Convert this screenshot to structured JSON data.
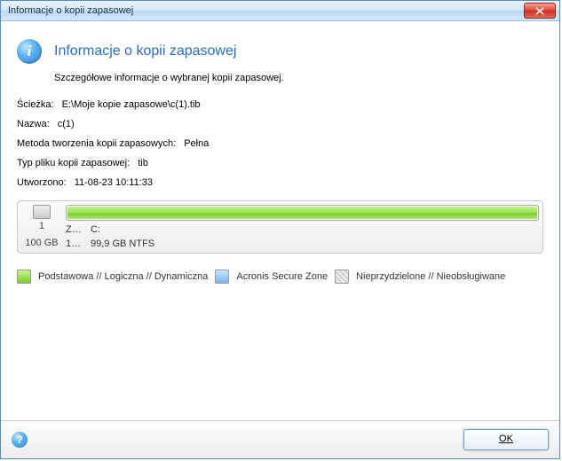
{
  "window": {
    "title": "Informacje o kopii zapasowej"
  },
  "header": {
    "title": "Informacje o kopii zapasowej",
    "subtitle": "Szczegółowe informacje o wybranej kopii zapasowej."
  },
  "fields": {
    "path_label": "Ścieżka:",
    "path_value": "E:\\Moje kopie zapasowe\\c(1).tib",
    "name_label": "Nazwa:",
    "name_value": "c(1)",
    "method_label": "Metoda tworzenia kopii zapasowych:",
    "method_value": "Pełna",
    "filetype_label": "Typ pliku kopii zapasowej:",
    "filetype_value": "tib",
    "created_label": "Utworzono:",
    "created_value": "11-08-23 10:11:33"
  },
  "disk": {
    "index": "1",
    "capacity": "100 GB",
    "row1_col1": "Z…",
    "row1_col2": "C:",
    "row2_col1": "1…",
    "row2_col2": "99,9 GB  NTFS"
  },
  "legend": {
    "item1": "Podstawowa // Logiczna // Dynamiczna",
    "item2": "Acronis Secure Zone",
    "item3": "Nieprzydzielone // Nieobsługiwane"
  },
  "footer": {
    "ok_letter": "O",
    "ok_rest": "K"
  }
}
